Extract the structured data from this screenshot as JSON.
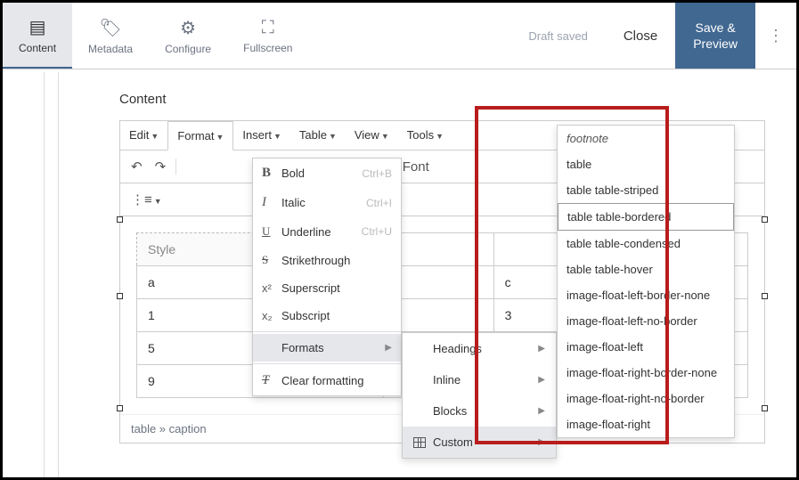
{
  "tabs": {
    "content": "Content",
    "metadata": "Metadata",
    "configure": "Configure",
    "fullscreen": "Fullscreen"
  },
  "status": "Draft saved",
  "close": "Close",
  "save1": "Save &",
  "save2": "Preview",
  "section": "Content",
  "menu": {
    "edit": "Edit",
    "format": "Format",
    "insert": "Insert",
    "table": "Table",
    "view": "View",
    "tools": "Tools"
  },
  "fmt": {
    "bold": "Bold",
    "bold_s": "Ctrl+B",
    "italic": "Italic",
    "italic_s": "Ctrl+I",
    "underline": "Underline",
    "underline_s": "Ctrl+U",
    "strike": "Strikethrough",
    "sup": "Superscript",
    "sub": "Subscript",
    "formats": "Formats",
    "clear": "Clear formatting"
  },
  "sub1": {
    "headings": "Headings",
    "inline": "Inline",
    "blocks": "Blocks",
    "custom": "Custom"
  },
  "custom": [
    "footnote",
    "table",
    "table table-striped",
    "table table-bordered",
    "table table-condensed",
    "table table-hover",
    "image-float-left-border-none",
    "image-float-left-no-border",
    "image-float-left",
    "image-float-right-border-none",
    "image-float-right-no-border",
    "image-float-right"
  ],
  "table": {
    "style": "Style",
    "a": "a",
    "c": "c",
    "r1": [
      "1",
      "3"
    ],
    "r2": [
      "5",
      ""
    ],
    "r3": [
      "9",
      ""
    ]
  },
  "path": "table » caption",
  "tb_font": "Font"
}
